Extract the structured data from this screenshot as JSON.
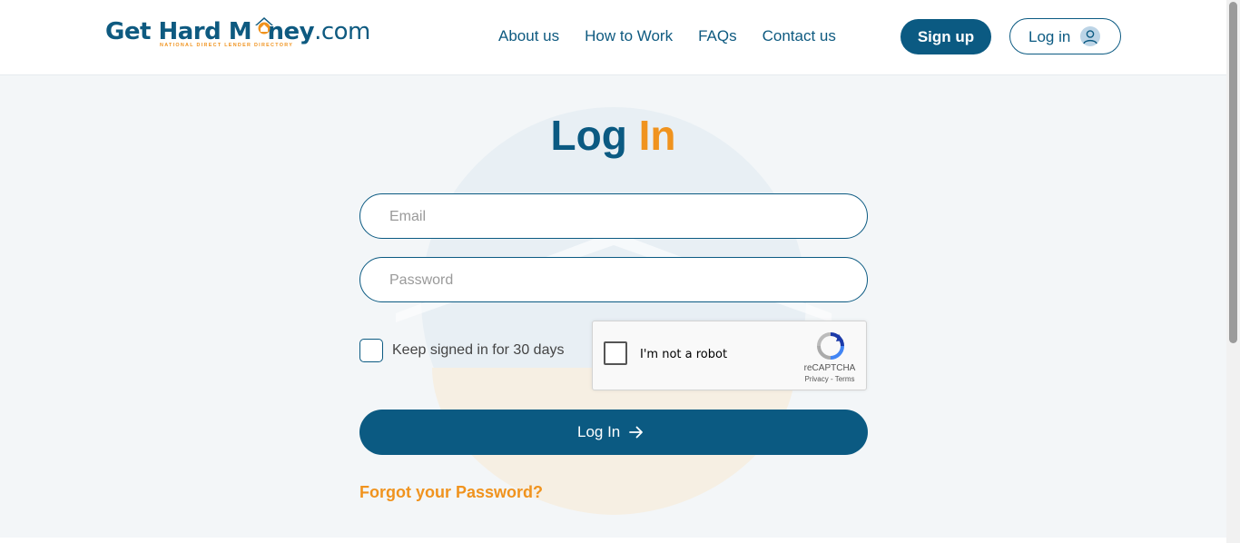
{
  "brand": {
    "name_part1": "Get Hard M",
    "name_part2": "ney",
    "name_tld": ".com",
    "tagline": "NATIONAL DIRECT LENDER DIRECTORY"
  },
  "nav": {
    "items": [
      "About us",
      "How to Work",
      "FAQs",
      "Contact us"
    ]
  },
  "header_actions": {
    "signup_label": "Sign up",
    "login_label": "Log in"
  },
  "page": {
    "title_part1": "Log",
    "title_part2": "In"
  },
  "form": {
    "email_placeholder": "Email",
    "password_placeholder": "Password",
    "keep_signed_label": "Keep signed in for 30 days",
    "submit_label": "Log In",
    "forgot_label": "Forgot your Password?"
  },
  "captcha": {
    "label": "I'm not a robot",
    "brand": "reCAPTCHA",
    "links": "Privacy - Terms"
  },
  "colors": {
    "primary": "#0b5a82",
    "accent": "#f0931e",
    "background": "#f3f6f8"
  }
}
